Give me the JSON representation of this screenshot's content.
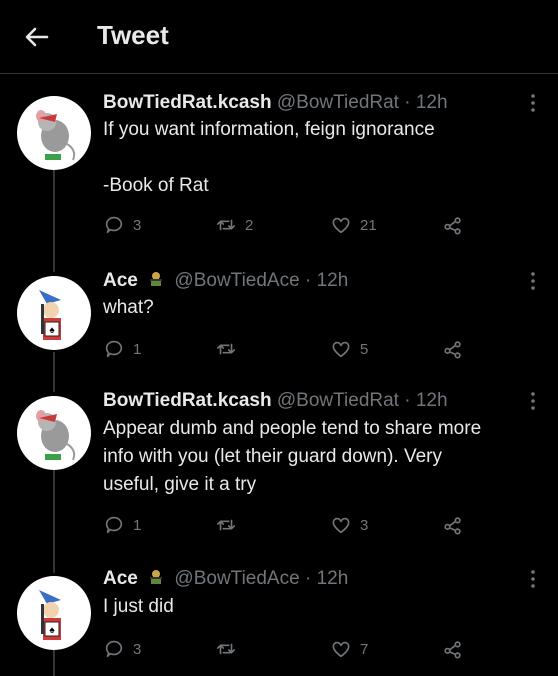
{
  "header": {
    "title": "Tweet"
  },
  "tweets": [
    {
      "name": "BowTiedRat.kcash",
      "handle": "@BowTiedRat",
      "sep": "·",
      "time": "12h",
      "lines": [
        "If you want information, feign ignorance",
        "",
        "-Book of Rat"
      ],
      "reply_count": "3",
      "retweet_count": "2",
      "like_count": "21"
    },
    {
      "name": "Ace",
      "handle": "@BowTiedAce",
      "sep": "·",
      "time": "12h",
      "lines": [
        "what?"
      ],
      "reply_count": "1",
      "retweet_count": "",
      "like_count": "5"
    },
    {
      "name": "BowTiedRat.kcash",
      "handle": "@BowTiedRat",
      "sep": "·",
      "time": "12h",
      "lines": [
        "Appear dumb and people tend to share more",
        "info with you (let their guard down). Very",
        "useful, give it a try"
      ],
      "reply_count": "1",
      "retweet_count": "",
      "like_count": "3"
    },
    {
      "name": "Ace",
      "handle": "@BowTiedAce",
      "sep": "·",
      "time": "12h",
      "lines": [
        "I just did"
      ],
      "reply_count": "3",
      "retweet_count": "",
      "like_count": "7"
    }
  ],
  "icons": {
    "back": "arrow-left-icon",
    "reply": "reply-icon",
    "retweet": "retweet-icon",
    "like": "heart-icon",
    "share": "share-icon",
    "more": "more-icon",
    "badge": "ace-badge-icon"
  },
  "colors": {
    "background": "#000000",
    "text": "#e7e9ea",
    "secondary": "#71767b",
    "divider": "#2f3336"
  }
}
